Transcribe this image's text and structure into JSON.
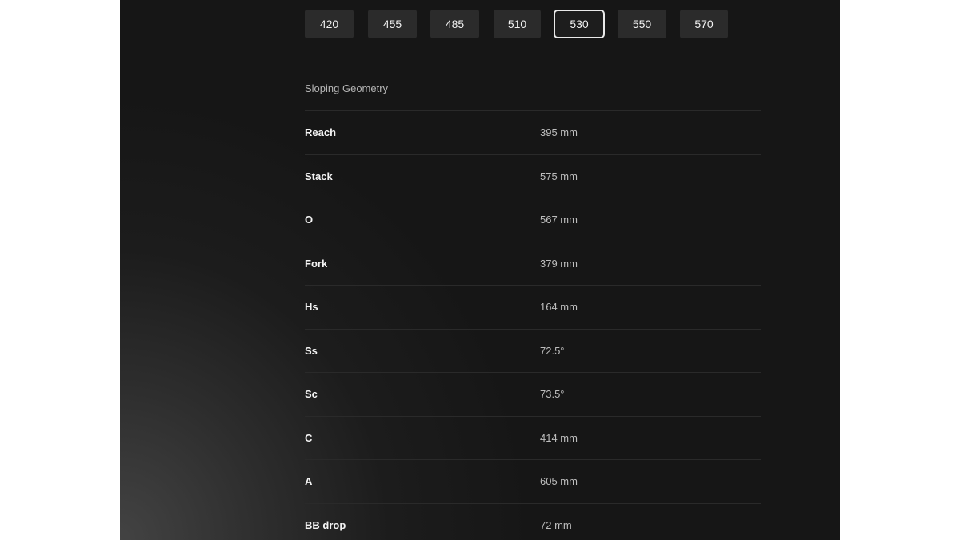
{
  "sizes": {
    "options": [
      "420",
      "455",
      "485",
      "510",
      "530",
      "550",
      "570"
    ],
    "selected": "530"
  },
  "geometry": {
    "title": "Sloping Geometry",
    "rows": [
      {
        "label": "Reach",
        "value": "395 mm"
      },
      {
        "label": "Stack",
        "value": "575 mm"
      },
      {
        "label": "O",
        "value": "567 mm"
      },
      {
        "label": "Fork",
        "value": "379 mm"
      },
      {
        "label": "Hs",
        "value": "164 mm"
      },
      {
        "label": "Ss",
        "value": "72.5°"
      },
      {
        "label": "Sc",
        "value": "73.5°"
      },
      {
        "label": "C",
        "value": "414 mm"
      },
      {
        "label": "A",
        "value": "605 mm"
      },
      {
        "label": "BB drop",
        "value": "72 mm"
      }
    ]
  }
}
